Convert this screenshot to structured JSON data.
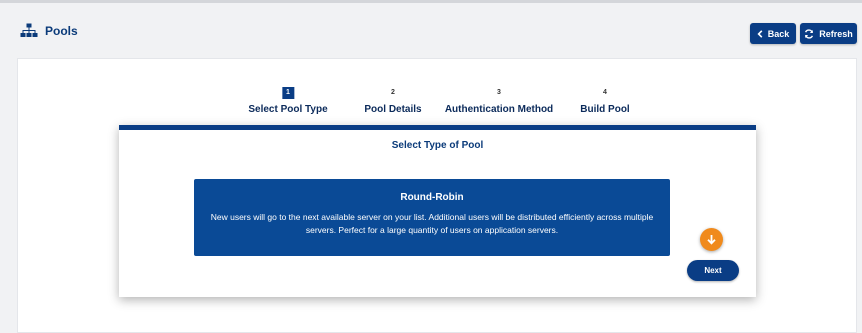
{
  "header": {
    "title": "Pools",
    "back_label": "Back",
    "refresh_label": "Refresh"
  },
  "steps": [
    {
      "number": "1",
      "label": "Select Pool Type",
      "active": true
    },
    {
      "number": "2",
      "label": "Pool Details",
      "active": false
    },
    {
      "number": "3",
      "label": "Authentication Method",
      "active": false
    },
    {
      "number": "4",
      "label": "Build Pool",
      "active": false
    }
  ],
  "card": {
    "title": "Select Type of Pool",
    "option": {
      "title": "Round-Robin",
      "description": "New users will go to the next available server on your list. Additional users will be distributed efficiently across multiple servers. Perfect for a large quantity of users on application servers."
    },
    "next_label": "Next"
  },
  "icons": {
    "header": "sitemap-icon",
    "back": "chevron-left-icon",
    "refresh": "refresh-icon",
    "scroll": "arrow-down-circle-icon"
  },
  "colors": {
    "primary": "#0a3d85",
    "option_bg": "#0a4a96",
    "accent_orange": "#f08a1c",
    "page_bg": "#f1f2f4"
  }
}
